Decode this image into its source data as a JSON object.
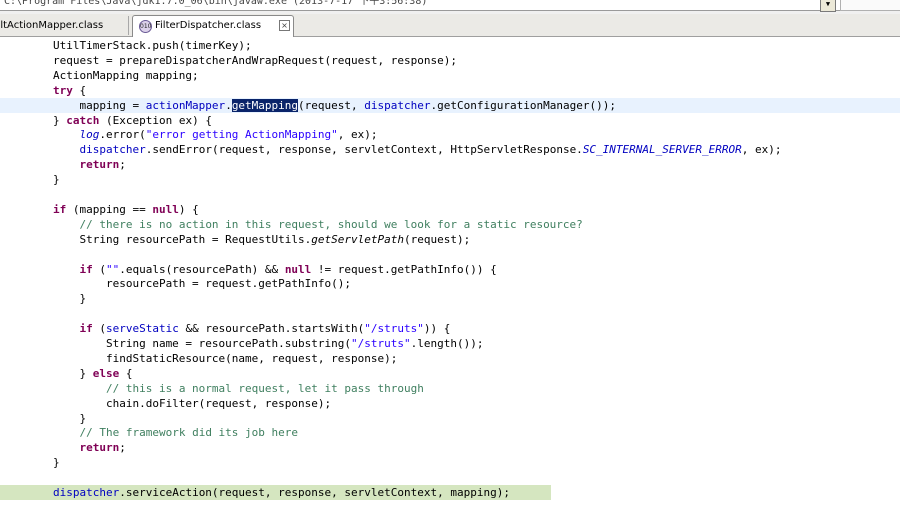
{
  "window": {
    "path_text": "C:\\Program Files\\Java\\jdk1.7.0_06\\bin\\javaw.exe (2013-7-17 下午3:56:38)",
    "dropdown_glyph": "▼"
  },
  "tabs": [
    {
      "label": "ultActionMapper.class",
      "active": false
    },
    {
      "label": "FilterDispatcher.class",
      "active": true,
      "icon": "class-file-icon",
      "close_glyph": "×"
    }
  ],
  "editor": {
    "selected_token": "getMapping",
    "lines": [
      {
        "segs": [
          {
            "t": "        UtilTimerStack.push(timerKey);"
          }
        ]
      },
      {
        "segs": [
          {
            "t": "        request = prepareDispatcherAndWrapRequest(request, response);"
          }
        ]
      },
      {
        "segs": [
          {
            "t": "        ActionMapping mapping;"
          }
        ]
      },
      {
        "segs": [
          {
            "t": "        ",
            "c": ""
          },
          {
            "t": "try",
            "c": "kw"
          },
          {
            "t": " {"
          }
        ]
      },
      {
        "hl": "selected",
        "segs": [
          {
            "t": "            mapping = "
          },
          {
            "t": "actionMapper",
            "c": "fd"
          },
          {
            "t": "."
          },
          {
            "t": "getMapping",
            "c": "sel"
          },
          {
            "t": "(request, "
          },
          {
            "t": "dispatcher",
            "c": "fd"
          },
          {
            "t": ".getConfigurationManager());"
          }
        ]
      },
      {
        "segs": [
          {
            "t": "        } "
          },
          {
            "t": "catch",
            "c": "kw"
          },
          {
            "t": " (Exception ex) {"
          }
        ]
      },
      {
        "segs": [
          {
            "t": "            "
          },
          {
            "t": "log",
            "c": "sc"
          },
          {
            "t": ".error("
          },
          {
            "t": "\"error getting ActionMapping\"",
            "c": "st"
          },
          {
            "t": ", ex);"
          }
        ]
      },
      {
        "segs": [
          {
            "t": "            "
          },
          {
            "t": "dispatcher",
            "c": "fd"
          },
          {
            "t": ".sendError(request, response, servletContext, HttpServletResponse."
          },
          {
            "t": "SC_INTERNAL_SERVER_ERROR",
            "c": "sc"
          },
          {
            "t": ", ex);"
          }
        ]
      },
      {
        "segs": [
          {
            "t": "            "
          },
          {
            "t": "return",
            "c": "kw"
          },
          {
            "t": ";"
          }
        ]
      },
      {
        "segs": [
          {
            "t": "        }"
          }
        ]
      },
      {
        "segs": [
          {
            "t": ""
          }
        ]
      },
      {
        "segs": [
          {
            "t": "        "
          },
          {
            "t": "if",
            "c": "kw"
          },
          {
            "t": " (mapping == "
          },
          {
            "t": "null",
            "c": "kw"
          },
          {
            "t": ") {"
          }
        ]
      },
      {
        "segs": [
          {
            "t": "            "
          },
          {
            "t": "// there is no action in this request, should we look for a static resource?",
            "c": "cm"
          }
        ]
      },
      {
        "segs": [
          {
            "t": "            String resourcePath = RequestUtils."
          },
          {
            "t": "getServletPath",
            "c": "it"
          },
          {
            "t": "(request);"
          }
        ]
      },
      {
        "segs": [
          {
            "t": ""
          }
        ]
      },
      {
        "segs": [
          {
            "t": "            "
          },
          {
            "t": "if",
            "c": "kw"
          },
          {
            "t": " ("
          },
          {
            "t": "\"\"",
            "c": "st"
          },
          {
            "t": ".equals(resourcePath) && "
          },
          {
            "t": "null",
            "c": "kw"
          },
          {
            "t": " != request.getPathInfo()) {"
          }
        ]
      },
      {
        "segs": [
          {
            "t": "                resourcePath = request.getPathInfo();"
          }
        ]
      },
      {
        "segs": [
          {
            "t": "            }"
          }
        ]
      },
      {
        "segs": [
          {
            "t": ""
          }
        ]
      },
      {
        "segs": [
          {
            "t": "            "
          },
          {
            "t": "if",
            "c": "kw"
          },
          {
            "t": " ("
          },
          {
            "t": "serveStatic",
            "c": "fd"
          },
          {
            "t": " && resourcePath.startsWith("
          },
          {
            "t": "\"/struts\"",
            "c": "st"
          },
          {
            "t": ")) {"
          }
        ]
      },
      {
        "segs": [
          {
            "t": "                String name = resourcePath.substring("
          },
          {
            "t": "\"/struts\"",
            "c": "st"
          },
          {
            "t": ".length());"
          }
        ]
      },
      {
        "segs": [
          {
            "t": "                findStaticResource(name, request, response);"
          }
        ]
      },
      {
        "segs": [
          {
            "t": "            } "
          },
          {
            "t": "else",
            "c": "kw"
          },
          {
            "t": " {"
          }
        ]
      },
      {
        "segs": [
          {
            "t": "                "
          },
          {
            "t": "// this is a normal request, let it pass through",
            "c": "cm"
          }
        ]
      },
      {
        "segs": [
          {
            "t": "                chain.doFilter(request, response);"
          }
        ]
      },
      {
        "segs": [
          {
            "t": "            }"
          }
        ]
      },
      {
        "segs": [
          {
            "t": "            "
          },
          {
            "t": "// The framework did its job here",
            "c": "cm"
          }
        ]
      },
      {
        "segs": [
          {
            "t": "            "
          },
          {
            "t": "return",
            "c": "kw"
          },
          {
            "t": ";"
          }
        ]
      },
      {
        "segs": [
          {
            "t": "        }"
          }
        ]
      },
      {
        "segs": [
          {
            "t": ""
          }
        ]
      },
      {
        "hl": "current",
        "segs": [
          {
            "t": "        "
          },
          {
            "t": "dispatcher",
            "c": "fd"
          },
          {
            "t": ".serviceAction(request, response, servletContext, mapping);"
          }
        ]
      }
    ]
  }
}
